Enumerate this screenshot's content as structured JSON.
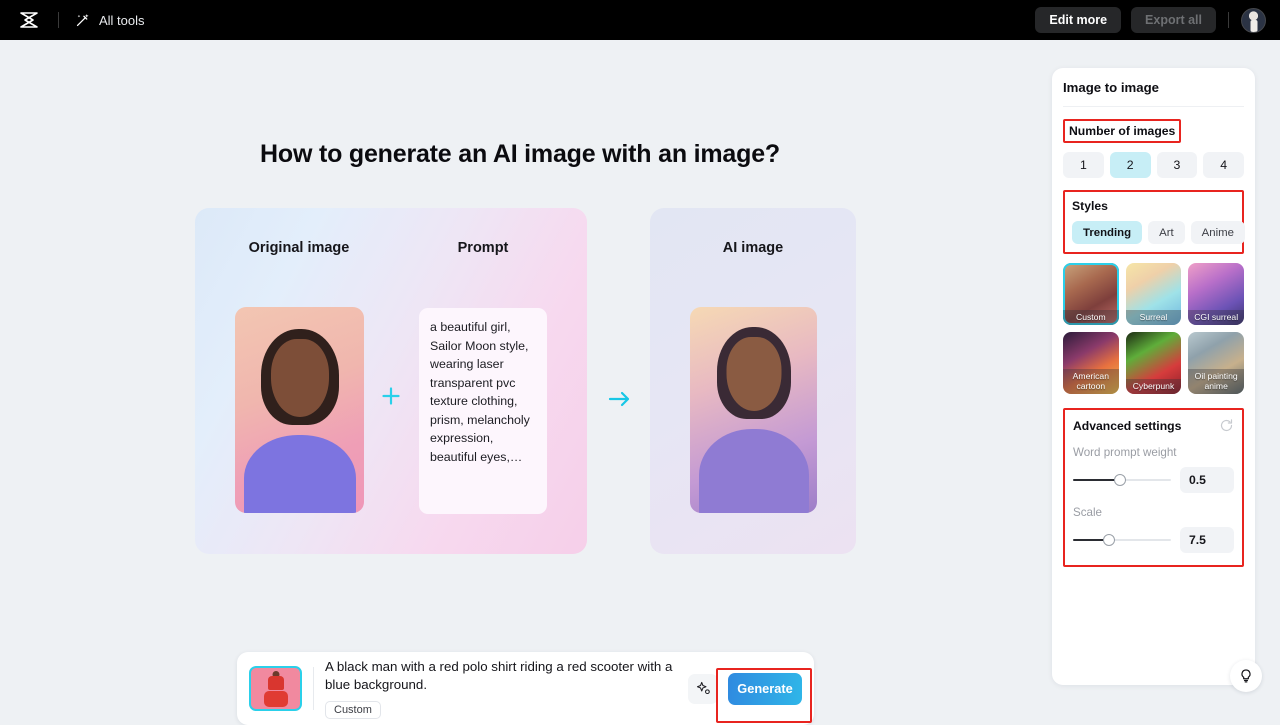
{
  "topbar": {
    "logo_icon": "capcut-logo-icon",
    "wand_icon": "magic-wand-icon",
    "all_tools_label": "All tools",
    "edit_more_label": "Edit more",
    "export_all_label": "Export all",
    "avatar_icon": "user-avatar"
  },
  "main": {
    "title": "How to generate an AI image with an image?",
    "original_heading": "Original image",
    "prompt_heading": "Prompt",
    "ai_heading": "AI image",
    "prompt_sample": "a beautiful girl, Sailor Moon style, wearing laser transparent pvc texture clothing, prism, melancholy expression, beautiful eyes,…",
    "plus_icon": "plus-icon",
    "arrow_icon": "arrow-right-icon"
  },
  "prompt_bar": {
    "thumbnail_icon": "uploaded-image-thumbnail",
    "prompt_line_1": "A black man with a red polo shirt riding a red scooter with a",
    "prompt_line_2": "blue background.",
    "style_tag": "Custom",
    "magic_icon": "sparkle-magic-icon",
    "generate_label": "Generate"
  },
  "panel": {
    "title": "Image to image",
    "number_of_images": {
      "label": "Number of images",
      "options": [
        "1",
        "2",
        "3",
        "4"
      ],
      "selected": "2"
    },
    "styles": {
      "label": "Styles",
      "tabs": [
        "Trending",
        "Art",
        "Anime"
      ],
      "selected_tab": "Trending",
      "tiles": [
        {
          "label": "Custom",
          "selected": true
        },
        {
          "label": "Surreal",
          "selected": false
        },
        {
          "label": "CGI surreal",
          "selected": false
        },
        {
          "label": "American cartoon",
          "selected": false
        },
        {
          "label": "Cyberpunk",
          "selected": false
        },
        {
          "label": "Oil painting anime",
          "selected": false
        }
      ]
    },
    "advanced": {
      "label": "Advanced settings",
      "reset_icon": "reset-icon",
      "word_prompt_weight": {
        "label": "Word prompt weight",
        "value": "0.5",
        "percent": 48
      },
      "scale": {
        "label": "Scale",
        "value": "7.5",
        "percent": 37
      }
    }
  },
  "help": {
    "bulb_icon": "lightbulb-icon"
  },
  "colors": {
    "accent_cyan": "#2ad0ea",
    "highlight_red": "#e8241f",
    "selected_chip": "#c7eef6",
    "generate_blue": "#2f9ae3"
  }
}
